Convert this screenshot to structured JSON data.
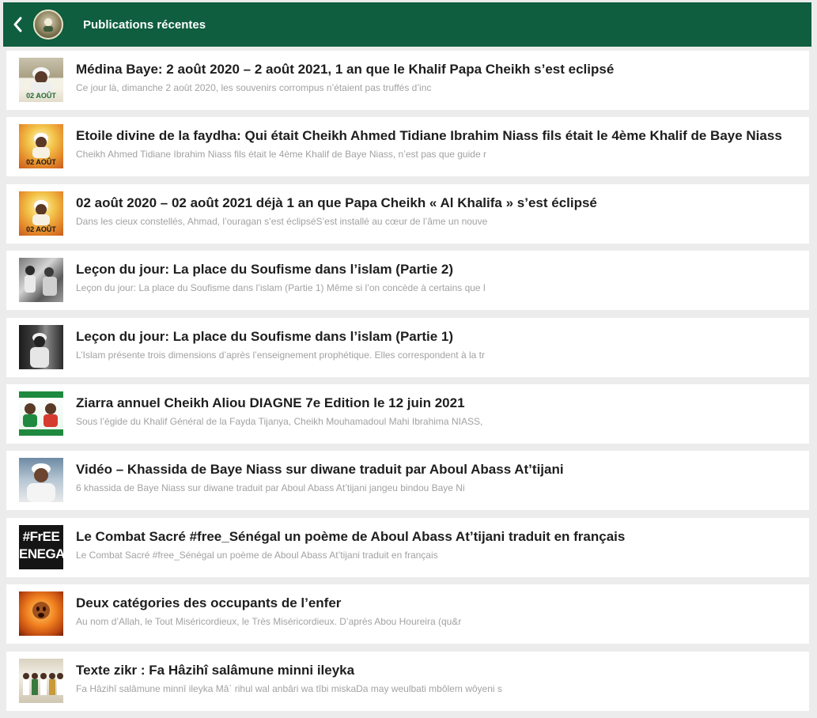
{
  "header": {
    "title": "Publications récentes",
    "back_icon": "chevron-left-icon",
    "logo": "site-logo",
    "bg_color": "#0e5e3f"
  },
  "posts": [
    {
      "title": "Médina Baye: 2 août 2020 – 2 août 2021, 1 an que le Khalif Papa Cheikh s’est eclipsé",
      "excerpt": "Ce jour là, dimanche 2 août 2020, les souvenirs corrompus n’étaient pas truffés d’inc",
      "thumb_label": "02 AOÛT"
    },
    {
      "title": "Etoile divine de la faydha: Qui était Cheikh Ahmed Tidiane Ibrahim Niass fils était le 4ème Khalif de Baye Niass",
      "excerpt": "Cheikh Ahmed Tidiane Ibrahim Niass fils était le 4ème Khalif de Baye Niass, n’est pas que guide r",
      "thumb_label": "02 AOÛT"
    },
    {
      "title": "02 août 2020 – 02 août 2021 déjà 1 an que Papa Cheikh « Al Khalifa » s’est éclipsé",
      "excerpt": "Dans les cieux constellés, Ahmad, l’ouragan s’est éclipséS’est installé au cœur de l’âme un nouve",
      "thumb_label": "02 AOÛT"
    },
    {
      "title": "Leçon du jour: La place du Soufisme dans l’islam (Partie 2)",
      "excerpt": "Leçon du jour: La place du Soufisme dans l’islam (Partie 1) Même si l’on concède à certains que l",
      "thumb_label": ""
    },
    {
      "title": "Leçon du jour: La place du Soufisme dans l’islam (Partie 1)",
      "excerpt": "L’Islam présente trois dimensions d’après l’enseignement prophétique. Elles correspondent à la tr",
      "thumb_label": ""
    },
    {
      "title": "Ziarra annuel Cheikh Aliou DIAGNE 7e Edition le 12 juin 2021",
      "excerpt": "Sous l’égide du Khalif Général de la Fayda Tijanya, Cheikh Mouhamadoul Mahi Ibrahima NIASS,",
      "thumb_label": ""
    },
    {
      "title": "Vidéo – Khassida de Baye Niass sur diwane traduit par Aboul Abass At’tijani",
      "excerpt": "6 khassida de Baye Niass sur diwane traduit par Aboul Abass At’tijani jangeu bindou Baye Ni",
      "thumb_label": ""
    },
    {
      "title": "Le Combat Sacré #free_Sénégal un poème de Aboul Abass At’tijani traduit en français",
      "excerpt": "Le Combat Sacré #free_Sénégal un poème de Aboul Abass At’tijani traduit en français",
      "thumb_label": "#FrEE ENEGA"
    },
    {
      "title": "Deux catégories des occupants de l’enfer",
      "excerpt": "Au nom d’Allah, le Tout Miséricordieux, le Très Miséricordieux. D’après Abou Houreira (qu&r",
      "thumb_label": ""
    },
    {
      "title": "Texte zikr : Fa Hâzihî salâmune minni ileyka",
      "excerpt": "Fa Hâzihî salâmune minnî ileyka Mâ` rihul wal anbâri wa tîbi miskaDa may weulbati mbôlem wôyeni s",
      "thumb_label": ""
    }
  ]
}
